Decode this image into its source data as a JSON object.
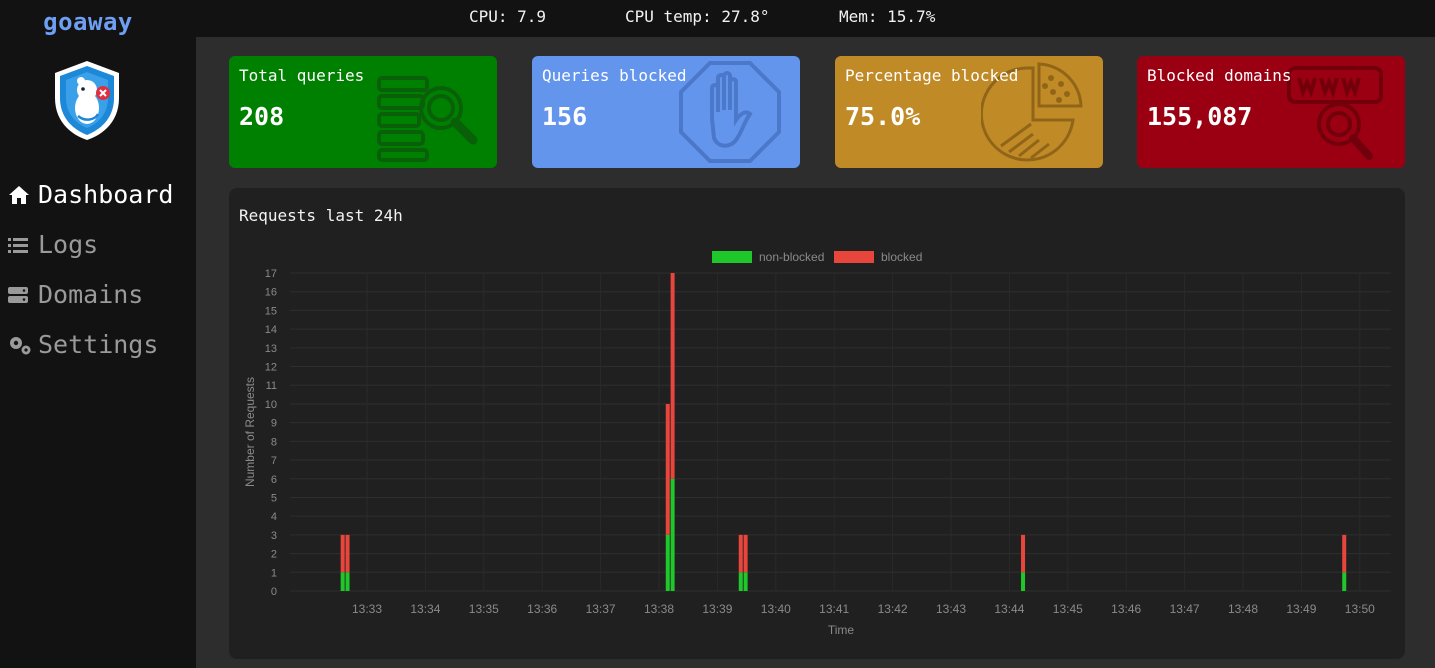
{
  "app": {
    "name": "goaway"
  },
  "nav": [
    {
      "label": "Dashboard",
      "icon": "home-icon",
      "active": true
    },
    {
      "label": "Logs",
      "icon": "list-icon",
      "active": false
    },
    {
      "label": "Domains",
      "icon": "server-icon",
      "active": false
    },
    {
      "label": "Settings",
      "icon": "gears-icon",
      "active": false
    }
  ],
  "stats": {
    "cpu": "CPU: 7.9",
    "cpu_temp": "CPU temp: 27.8°",
    "mem": "Mem: 15.7%"
  },
  "cards": [
    {
      "title": "Total queries",
      "value": "208",
      "color": "#008000",
      "icon": "search-list-icon"
    },
    {
      "title": "Queries blocked",
      "value": "156",
      "color": "#6495ed",
      "icon": "stop-hand-icon"
    },
    {
      "title": "Percentage blocked",
      "value": "75.0%",
      "color": "#c08a26",
      "icon": "pie-chart-icon"
    },
    {
      "title": "Blocked domains",
      "value": "155,087",
      "color": "#9b0012",
      "icon": "web-search-icon"
    }
  ],
  "panel": {
    "title": "Requests last 24h"
  },
  "chart_data": {
    "type": "bar",
    "stacked": true,
    "xlabel": "Time",
    "ylabel": "Number of Requests",
    "ylim": [
      0,
      17
    ],
    "yticks": [
      0,
      1,
      2,
      3,
      4,
      5,
      6,
      7,
      8,
      9,
      10,
      11,
      12,
      13,
      14,
      15,
      16,
      17
    ],
    "xticks": [
      "13:33",
      "13:34",
      "13:35",
      "13:36",
      "13:37",
      "13:38",
      "13:39",
      "13:40",
      "13:41",
      "13:42",
      "13:43",
      "13:44",
      "13:45",
      "13:46",
      "13:47",
      "13:48",
      "13:49",
      "13:50"
    ],
    "legend": "top-center",
    "series": [
      {
        "name": "non-blocked",
        "color": "#1fc72a",
        "points": [
          {
            "x": "13:32:35",
            "y": 1
          },
          {
            "x": "13:32:40",
            "y": 1
          },
          {
            "x": "13:38:09",
            "y": 3
          },
          {
            "x": "13:38:14",
            "y": 6
          },
          {
            "x": "13:39:24",
            "y": 1
          },
          {
            "x": "13:39:29",
            "y": 1
          },
          {
            "x": "13:44:14",
            "y": 1
          },
          {
            "x": "13:49:44",
            "y": 1
          }
        ]
      },
      {
        "name": "blocked",
        "color": "#e8453c",
        "points": [
          {
            "x": "13:32:35",
            "y": 2
          },
          {
            "x": "13:32:40",
            "y": 2
          },
          {
            "x": "13:38:09",
            "y": 7
          },
          {
            "x": "13:38:14",
            "y": 11
          },
          {
            "x": "13:39:24",
            "y": 2
          },
          {
            "x": "13:39:29",
            "y": 2
          },
          {
            "x": "13:44:14",
            "y": 2
          },
          {
            "x": "13:49:44",
            "y": 2
          }
        ]
      }
    ]
  }
}
